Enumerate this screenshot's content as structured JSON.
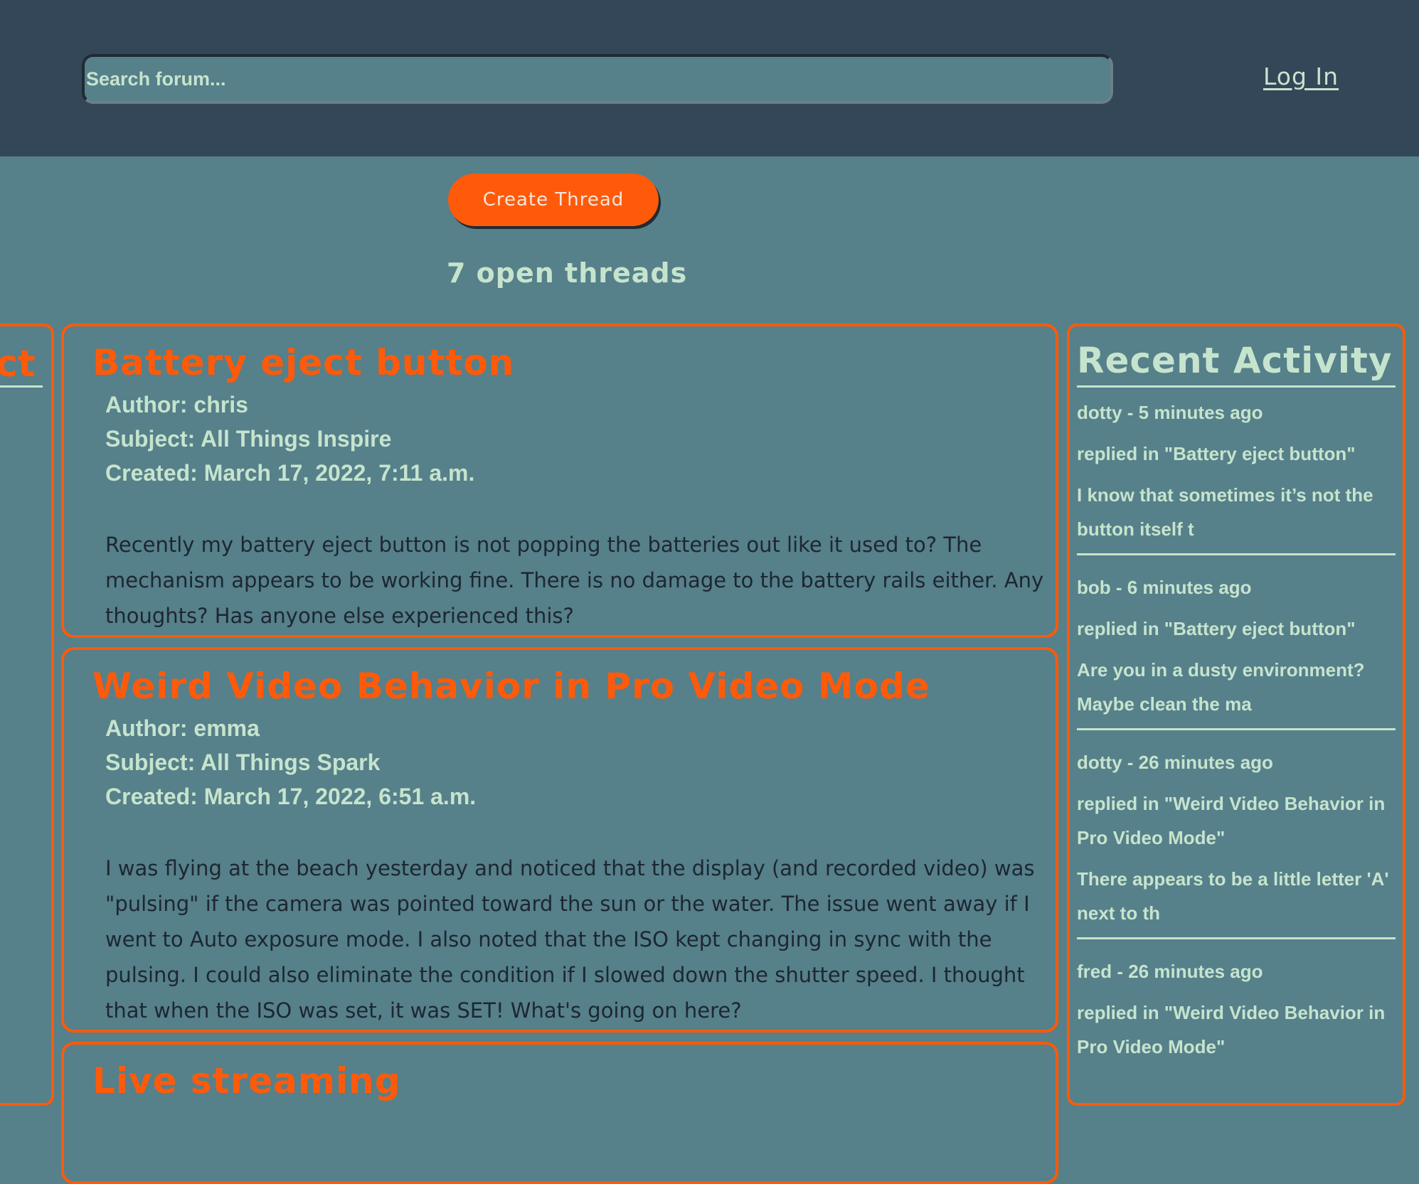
{
  "header": {
    "search_placeholder": "Search forum...",
    "login_label": "Log In"
  },
  "toolbar": {
    "create_thread_label": "Create Thread",
    "open_threads_text": "7 open threads"
  },
  "left_panel": {
    "title_fragment": "ct"
  },
  "threads": [
    {
      "title": "Battery eject button",
      "author": "Author: chris",
      "subject": "Subject: All Things Inspire",
      "created": "Created: March 17, 2022, 7:11 a.m.",
      "body": "Recently my battery eject button is not popping the batteries out like it used to? The mechanism appears to be working fine. There is no damage to the battery rails either. Any thoughts? Has anyone else experienced this?"
    },
    {
      "title": "Weird Video Behavior in Pro Video Mode",
      "author": "Author: emma",
      "subject": "Subject: All Things Spark",
      "created": "Created: March 17, 2022, 6:51 a.m.",
      "body": "I was flying at the beach yesterday and noticed that the display (and recorded video) was \"pulsing\" if the camera was pointed toward the sun or the water. The issue went away if I went to Auto exposure mode. I also noted that the ISO kept changing in sync with the pulsing. I could also eliminate the condition if I slowed down the shutter speed. I thought that when the ISO was set, it was SET! What's going on here?"
    },
    {
      "title": "Live streaming"
    }
  ],
  "recent_activity": {
    "title": "Recent Activity",
    "items": [
      {
        "who": "dotty - 5 minutes ago",
        "where": "replied in \"Battery eject button\"",
        "snippet": "I know that sometimes it’s not the button itself t"
      },
      {
        "who": "bob - 6 minutes ago",
        "where": "replied in \"Battery eject button\"",
        "snippet": "Are you in a dusty environment? Maybe clean the ma"
      },
      {
        "who": "dotty - 26 minutes ago",
        "where": "replied in \"Weird Video Behavior in Pro Video Mode\"",
        "snippet": "There appears to be a little letter 'A' next to th"
      },
      {
        "who": "fred - 26 minutes ago",
        "where": "replied in \"Weird Video Behavior in Pro Video Mode\""
      }
    ]
  },
  "colors": {
    "header_bg": "#344758",
    "page_bg": "#56808a",
    "accent": "#ff5a0a",
    "text_light": "#c6e4cd",
    "text_dark": "#1c2732"
  }
}
